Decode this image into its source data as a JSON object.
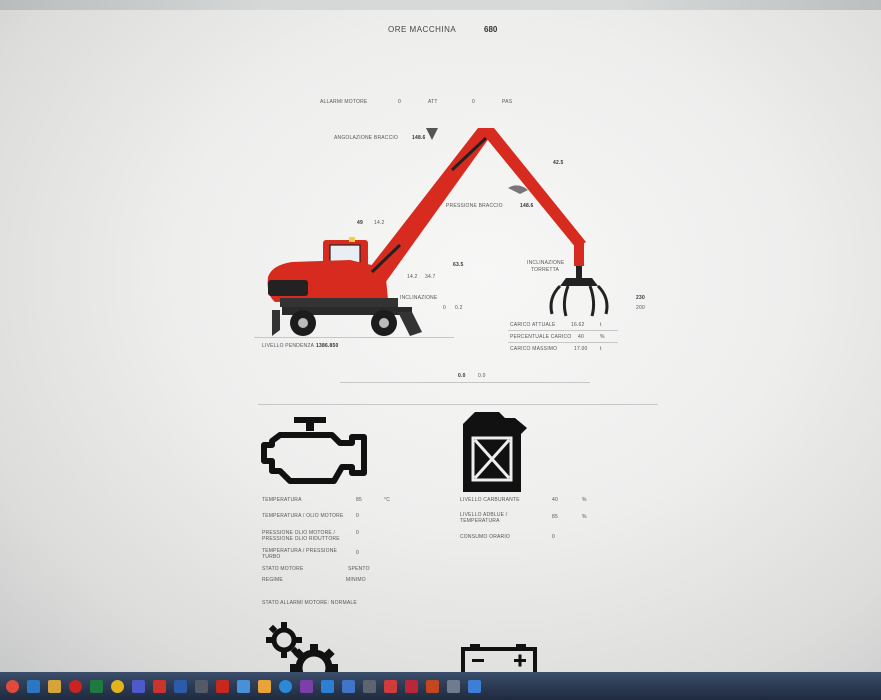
{
  "header": {
    "title": "ORE MACCHINA",
    "hours": "680"
  },
  "machine": {
    "labels": [
      {
        "text": "ALLARMI MOTORE"
      },
      {
        "text": "0"
      },
      {
        "text": "ATT"
      },
      {
        "text": "0"
      },
      {
        "text": "PAS"
      },
      {
        "text": "ANGOLAZIONE BRACCIO"
      },
      {
        "text": "148.6"
      },
      {
        "text": "42.5"
      },
      {
        "text": "PRESSIONE BRACCIO"
      },
      {
        "text": "148.6"
      },
      {
        "text": "49"
      },
      {
        "text": "14.2"
      },
      {
        "text": "63.5"
      },
      {
        "text": "14.2"
      },
      {
        "text": "34.7"
      },
      {
        "text": "INCLINAZIONE"
      },
      {
        "text": "TORRETTA"
      },
      {
        "text": "INCLINAZIONE"
      },
      {
        "text": "0"
      },
      {
        "text": "0.2"
      },
      {
        "text": "230"
      },
      {
        "text": "200"
      },
      {
        "text": "CARICO ATTUALE"
      },
      {
        "text": "16.62"
      },
      {
        "text": "t"
      },
      {
        "text": "PERCENTUALE CARICO"
      },
      {
        "text": "40"
      },
      {
        "text": "%"
      },
      {
        "text": "CARICO MASSIMO"
      },
      {
        "text": "17.00"
      },
      {
        "text": "t"
      },
      {
        "text": "LIVELLO PENDENZA"
      },
      {
        "text": "1386.850"
      },
      {
        "text": "0.0"
      },
      {
        "text": "0.0"
      }
    ]
  },
  "engine_panel": {
    "rows": [
      {
        "label": "TEMPERATURA",
        "value": "85",
        "unit": "°C"
      },
      {
        "label": "TEMPERATURA / OLIO MOTORE",
        "value": "0",
        "unit": ""
      },
      {
        "label": "PRESSIONE OLIO MOTORE / PRESSIONE OLIO RIDUTTORE",
        "value": "0",
        "unit": ""
      },
      {
        "label": "TEMPERATURA / PRESSIONE TURBO",
        "value": "0",
        "unit": ""
      },
      {
        "label": "STATO MOTORE",
        "value": "SPENTO",
        "unit": ""
      },
      {
        "label": "REGIME",
        "value": "MINIMO",
        "unit": ""
      }
    ],
    "footer": "STATO ALLARMI MOTORE: NORMALE"
  },
  "fuel_panel": {
    "rows": [
      {
        "label": "LIVELLO CARBURANTE",
        "value": "40",
        "unit": "%"
      },
      {
        "label": "LIVELLO ADBLUE / TEMPERATURA",
        "value": "85",
        "unit": "%"
      },
      {
        "label": "CONSUMO ORARIO",
        "value": "0",
        "unit": ""
      }
    ]
  },
  "taskbar": {
    "icons": [
      {
        "name": "chrome-icon",
        "color": "#e04a3a"
      },
      {
        "name": "ie-icon",
        "color": "#2b77c4"
      },
      {
        "name": "folder-icon",
        "color": "#d7a43c"
      },
      {
        "name": "opera-icon",
        "color": "#cc2222"
      },
      {
        "name": "excel-icon",
        "color": "#1f7a3f"
      },
      {
        "name": "maps-icon",
        "color": "#e3b41a"
      },
      {
        "name": "teams-icon",
        "color": "#5059c9"
      },
      {
        "name": "mail-icon",
        "color": "#c9342c"
      },
      {
        "name": "word-icon",
        "color": "#2b5ba9"
      },
      {
        "name": "store-icon",
        "color": "#555b66"
      },
      {
        "name": "acrobat-icon",
        "color": "#c8271c"
      },
      {
        "name": "photos-icon",
        "color": "#4a90d9"
      },
      {
        "name": "paint-icon",
        "color": "#e8a33a"
      },
      {
        "name": "edge-icon",
        "color": "#2a8ad8"
      },
      {
        "name": "app-icon",
        "color": "#7a3fa8"
      },
      {
        "name": "calendar-icon",
        "color": "#2d7fd1"
      },
      {
        "name": "notes-icon",
        "color": "#4175c7"
      },
      {
        "name": "printer-icon",
        "color": "#5d6570"
      },
      {
        "name": "security-icon",
        "color": "#d23b3b"
      },
      {
        "name": "game-icon",
        "color": "#b8283a"
      },
      {
        "name": "powerpoint-icon",
        "color": "#c3461f"
      },
      {
        "name": "window-icon",
        "color": "#6f7b8f"
      },
      {
        "name": "explorer-icon",
        "color": "#3d7ed6"
      }
    ]
  }
}
